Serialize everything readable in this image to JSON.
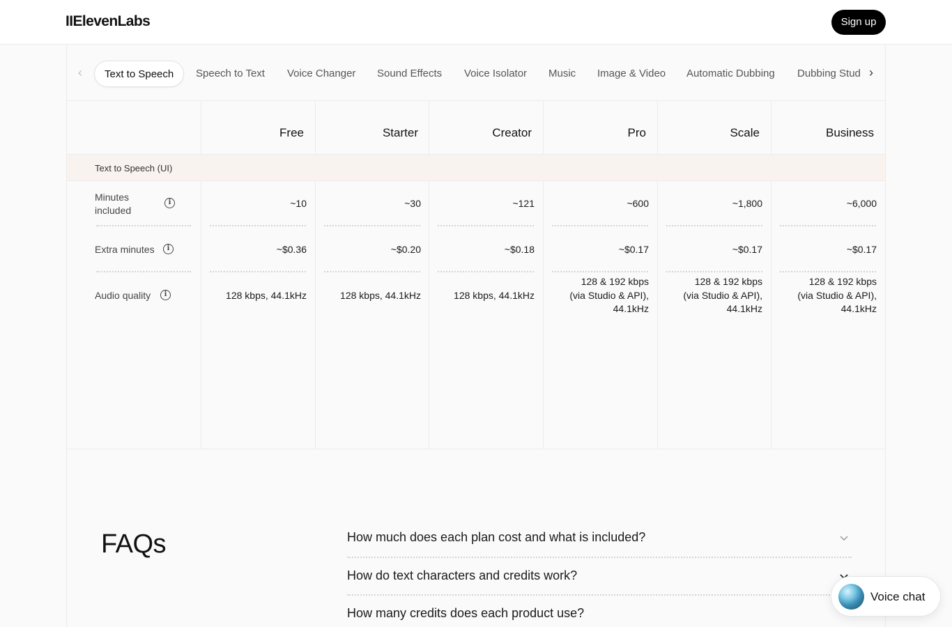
{
  "header": {
    "logo": "IIElevenLabs",
    "signup_label": "Sign up"
  },
  "tabs": {
    "items": [
      "Text to Speech",
      "Speech to Text",
      "Voice Changer",
      "Sound Effects",
      "Voice Isolator",
      "Music",
      "Image & Video",
      "Automatic Dubbing",
      "Dubbing Stud"
    ],
    "active": "Text to Speech",
    "prev_icon": "chevron-left-icon",
    "next_icon": "chevron-right-icon"
  },
  "plans": [
    "Free",
    "Starter",
    "Creator",
    "Pro",
    "Scale",
    "Business"
  ],
  "section": {
    "title": "Text to Speech (UI)"
  },
  "rows": [
    {
      "label_line1": "Minutes",
      "label_line2": "included",
      "values": [
        "~10",
        "~30",
        "~121",
        "~600",
        "~1,800",
        "~6,000"
      ]
    },
    {
      "label": "Extra minutes",
      "values": [
        "~$0.36",
        "~$0.20",
        "~$0.18",
        "~$0.17",
        "~$0.17",
        "~$0.17"
      ]
    },
    {
      "label": "Audio quality",
      "values_simple": [
        "128 kbps, 44.1kHz",
        "128 kbps, 44.1kHz",
        "128 kbps, 44.1kHz"
      ],
      "values_multi": [
        [
          "128 & 192 kbps",
          "(via Studio & API),",
          "44.1kHz"
        ],
        [
          "128 & 192 kbps",
          "(via Studio & API),",
          "44.1kHz"
        ],
        [
          "128 & 192 kbps",
          "(via Studio & API),",
          "44.1kHz"
        ]
      ]
    }
  ],
  "info_icon": "info-icon",
  "faq": {
    "title": "FAQs",
    "questions": [
      "How much does each plan cost and what is included?",
      "How do text characters and credits work?",
      "How many credits does each product use?"
    ]
  },
  "voice_chat": {
    "label": "Voice chat"
  }
}
